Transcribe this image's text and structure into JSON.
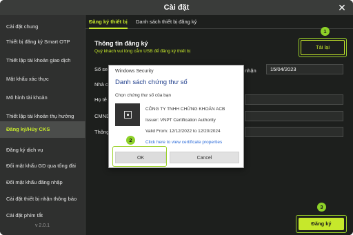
{
  "window": {
    "title": "Cài đặt",
    "close_symbol": "✕"
  },
  "sidebar": {
    "items": [
      {
        "label": "Cài đặt chung"
      },
      {
        "label": "Thiết bị đăng ký Smart OTP"
      },
      {
        "label": "Thiết lập tài khoản giao dịch"
      },
      {
        "label": "Mật khẩu xác thực"
      },
      {
        "label": "Mô hình tài khoản"
      },
      {
        "label": "Thiết lập tài khoản thụ hưởng"
      },
      {
        "label": "Đăng ký/Hủy CKS",
        "active": true
      },
      {
        "label": "Đăng ký dịch vụ"
      },
      {
        "label": "Đổi mật khẩu GD qua tổng đài"
      },
      {
        "label": "Đổi mật khẩu đăng nhập"
      },
      {
        "label": "Cài đặt thiết bị nhận thông báo"
      },
      {
        "label": "Cài đặt phím tắt"
      }
    ],
    "version": "v 2.0.1"
  },
  "tabs": [
    {
      "label": "Đăng ký thiết bị",
      "active": true
    },
    {
      "label": "Danh sách thiết bị đăng ký"
    }
  ],
  "form": {
    "title": "Thông tin đăng ký",
    "hint": "Quý khách vui lòng cắm USB để đăng ký thiết bị",
    "reload_button": "Tải lại",
    "register_button": "Đăng ký",
    "labels": [
      "Số se",
      "Nhà c",
      "Họ tê",
      "CMND",
      "Thông"
    ],
    "date_label": "nhận",
    "date_value": "15/04/2023"
  },
  "callouts": {
    "one": "1",
    "two": "2",
    "three": "3"
  },
  "dialog": {
    "title": "Windows Security",
    "heading": "Danh sách chứng thư số",
    "subheading": "Chọn chứng thư số của bạn",
    "cert": {
      "name": "CÔNG TY TNHH CHỨNG KHOÁN ACB",
      "issuer": "Issuer: VNPT Certification Authority",
      "valid": "Valid From: 12/12/2022 to 12/20/2024",
      "link": "Click here to view certificate properties"
    },
    "ok_button": "OK",
    "cancel_button": "Cancel"
  },
  "colors": {
    "accent": "#c6e82b",
    "callout": "#8dd128",
    "background": "#1d1f1d"
  }
}
